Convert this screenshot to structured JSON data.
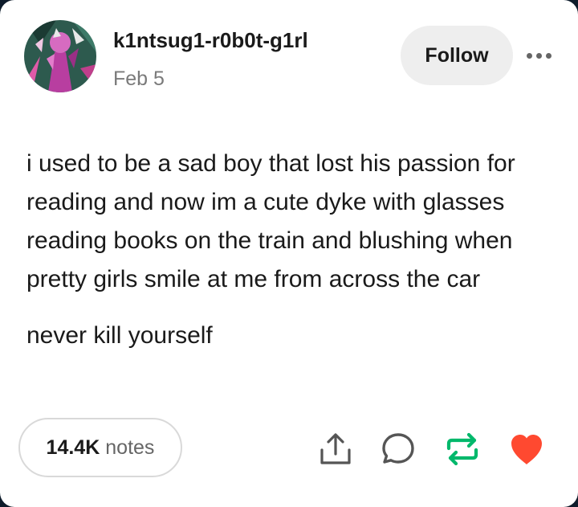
{
  "post": {
    "username": "k1ntsug1-r0b0t-g1rl",
    "date": "Feb 5",
    "paragraphs": [
      "i used to be a sad boy that lost his passion for reading and now im a cute dyke with glasses reading books on the train and blushing when pretty girls smile at me from across the car",
      "never kill yourself"
    ]
  },
  "header": {
    "follow_label": "Follow",
    "more_icon": "ellipsis-icon"
  },
  "footer": {
    "notes_count": "14.4K",
    "notes_label": "notes",
    "actions": [
      "share-icon",
      "reply-icon",
      "reblog-icon",
      "like-icon"
    ]
  },
  "colors": {
    "reblog": "#00b86b",
    "like": "#ff4930",
    "date": "#7a7a7a",
    "follow_bg": "#eeeeee"
  }
}
